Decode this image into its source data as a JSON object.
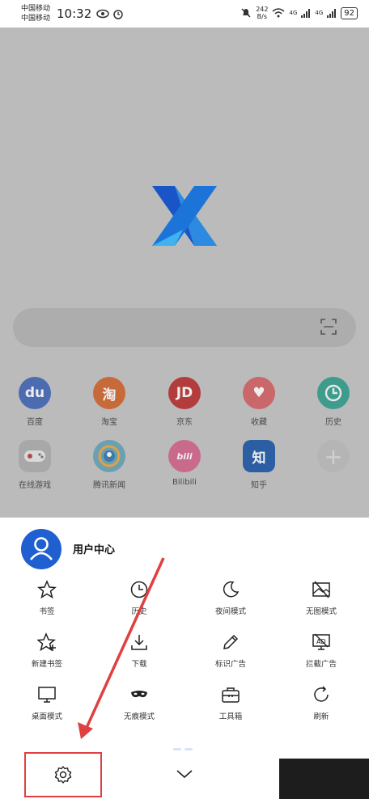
{
  "status_bar": {
    "carrier1": "中国移动",
    "carrier2": "中国移动",
    "time": "10:32",
    "net_speed_value": "242",
    "net_speed_unit": "B/s",
    "signal1": "4G",
    "signal2": "4G",
    "battery": "92"
  },
  "shortcuts": [
    {
      "label": "百度",
      "glyph": "du",
      "color": "#4d6bb0"
    },
    {
      "label": "淘宝",
      "glyph": "淘",
      "color": "#c76a3a"
    },
    {
      "label": "京东",
      "glyph": "JD",
      "color": "#b33c3c"
    },
    {
      "label": "收藏",
      "glyph": "♥",
      "color": "#c9676b"
    },
    {
      "label": "历史",
      "glyph": "◷",
      "color": "#3e9c8d"
    },
    {
      "label": "在线游戏",
      "glyph": "◉",
      "color": "#a8a8a8"
    },
    {
      "label": "腾讯新闻",
      "glyph": "◔",
      "color": "#6aa0b0"
    },
    {
      "label": "Bilibili",
      "glyph": "bili",
      "color": "#c96a8d"
    },
    {
      "label": "知乎",
      "glyph": "知",
      "color": "#2c5ea3"
    },
    {
      "label": "",
      "glyph": "+",
      "color": "#b5b5b5"
    }
  ],
  "user_center": {
    "title": "用户中心"
  },
  "menu": [
    {
      "label": "书签",
      "icon": "star-icon"
    },
    {
      "label": "历史",
      "icon": "clock-icon"
    },
    {
      "label": "夜间模式",
      "icon": "moon-icon"
    },
    {
      "label": "无图模式",
      "icon": "no-image-icon"
    },
    {
      "label": "新建书签",
      "icon": "star-plus-icon"
    },
    {
      "label": "下载",
      "icon": "download-icon"
    },
    {
      "label": "标识广告",
      "icon": "pen-icon"
    },
    {
      "label": "拦截广告",
      "icon": "ad-block-icon"
    },
    {
      "label": "桌面模式",
      "icon": "monitor-icon"
    },
    {
      "label": "无痕模式",
      "icon": "mask-icon"
    },
    {
      "label": "工具箱",
      "icon": "toolbox-icon"
    },
    {
      "label": "刷新",
      "icon": "refresh-icon"
    }
  ],
  "colors": {
    "accent": "#1f5fd0",
    "annotation": "#e04040"
  }
}
